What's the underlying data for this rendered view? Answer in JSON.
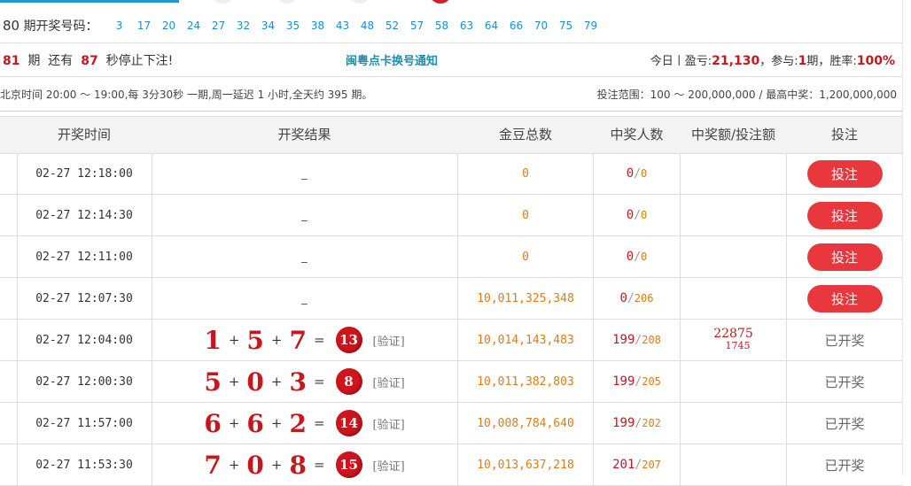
{
  "header": {
    "current_period_prefix": "80",
    "draw_codes_label": "期开奖号码：",
    "codes": [
      "3",
      "17",
      "20",
      "24",
      "27",
      "32",
      "34",
      "35",
      "38",
      "43",
      "48",
      "52",
      "57",
      "58",
      "63",
      "64",
      "66",
      "70",
      "75",
      "79"
    ]
  },
  "countdown": {
    "period": "81",
    "period_text": "期",
    "still_text": "还有",
    "seconds": "87",
    "stop_text": "秒停止下注!",
    "notice_link": "闽粤点卡换号通知",
    "today_label": "今日丨盈亏:",
    "profit": "21,130",
    "participate_label": "，参与:",
    "participate_count": "1",
    "period_unit": "期，",
    "winrate_label": "胜率:",
    "winrate": "100%"
  },
  "info": {
    "schedule": "北京时间 20:00 ～ 19:00,每 3分30秒 一期,周一延迟 1 小时,全天约 395 期。",
    "bet_range": "投注范围：100 ～ 200,000,000 / 最高中奖：1,200,000,000"
  },
  "table": {
    "headers": [
      "开奖时间",
      "开奖结果",
      "金豆总数",
      "中奖人数",
      "中奖额/投注额",
      "投注"
    ],
    "rows": [
      {
        "time": "02-27 12:18:00",
        "result": null,
        "placeholder": "_",
        "beans": "0",
        "winners": "0",
        "total": "0",
        "ratio_top": "",
        "ratio_bottom": "",
        "action": "投注",
        "open": true
      },
      {
        "time": "02-27 12:14:30",
        "result": null,
        "placeholder": "_",
        "beans": "0",
        "winners": "0",
        "total": "0",
        "ratio_top": "",
        "ratio_bottom": "",
        "action": "投注",
        "open": true
      },
      {
        "time": "02-27 12:11:00",
        "result": null,
        "placeholder": "_",
        "beans": "0",
        "winners": "0",
        "total": "0",
        "ratio_top": "",
        "ratio_bottom": "",
        "action": "投注",
        "open": true
      },
      {
        "time": "02-27 12:07:30",
        "result": null,
        "placeholder": "_",
        "beans": "10,011,325,348",
        "winners": "0",
        "total": "206",
        "ratio_top": "",
        "ratio_bottom": "",
        "action": "投注",
        "open": true
      },
      {
        "time": "02-27 12:04:00",
        "result": {
          "a": "1",
          "b": "5",
          "c": "7",
          "sum": "13"
        },
        "verify": "[验证]",
        "beans": "10,014,143,483",
        "winners": "199",
        "total": "208",
        "ratio_top": "22875",
        "ratio_bottom": "1745",
        "action": "已开奖",
        "open": false
      },
      {
        "time": "02-27 12:00:30",
        "result": {
          "a": "5",
          "b": "0",
          "c": "3",
          "sum": "8"
        },
        "verify": "[验证]",
        "beans": "10,011,382,803",
        "winners": "199",
        "total": "205",
        "ratio_top": "",
        "ratio_bottom": "",
        "action": "已开奖",
        "open": false
      },
      {
        "time": "02-27 11:57:00",
        "result": {
          "a": "6",
          "b": "6",
          "c": "2",
          "sum": "14"
        },
        "verify": "[验证]",
        "beans": "10,008,784,640",
        "winners": "199",
        "total": "202",
        "ratio_top": "",
        "ratio_bottom": "",
        "action": "已开奖",
        "open": false
      },
      {
        "time": "02-27 11:53:30",
        "result": {
          "a": "7",
          "b": "0",
          "c": "8",
          "sum": "15"
        },
        "verify": "[验证]",
        "beans": "10,013,637,218",
        "winners": "201",
        "total": "207",
        "ratio_top": "",
        "ratio_bottom": "",
        "action": "已开奖",
        "open": false
      }
    ]
  },
  "symbols": {
    "plus": "+",
    "equals": "=",
    "slash": "/"
  },
  "colors": {
    "accent_blue": "#1a9ad6",
    "red": "#c8161d",
    "bet_button": "#e8383d",
    "orange": "#e07b15"
  }
}
